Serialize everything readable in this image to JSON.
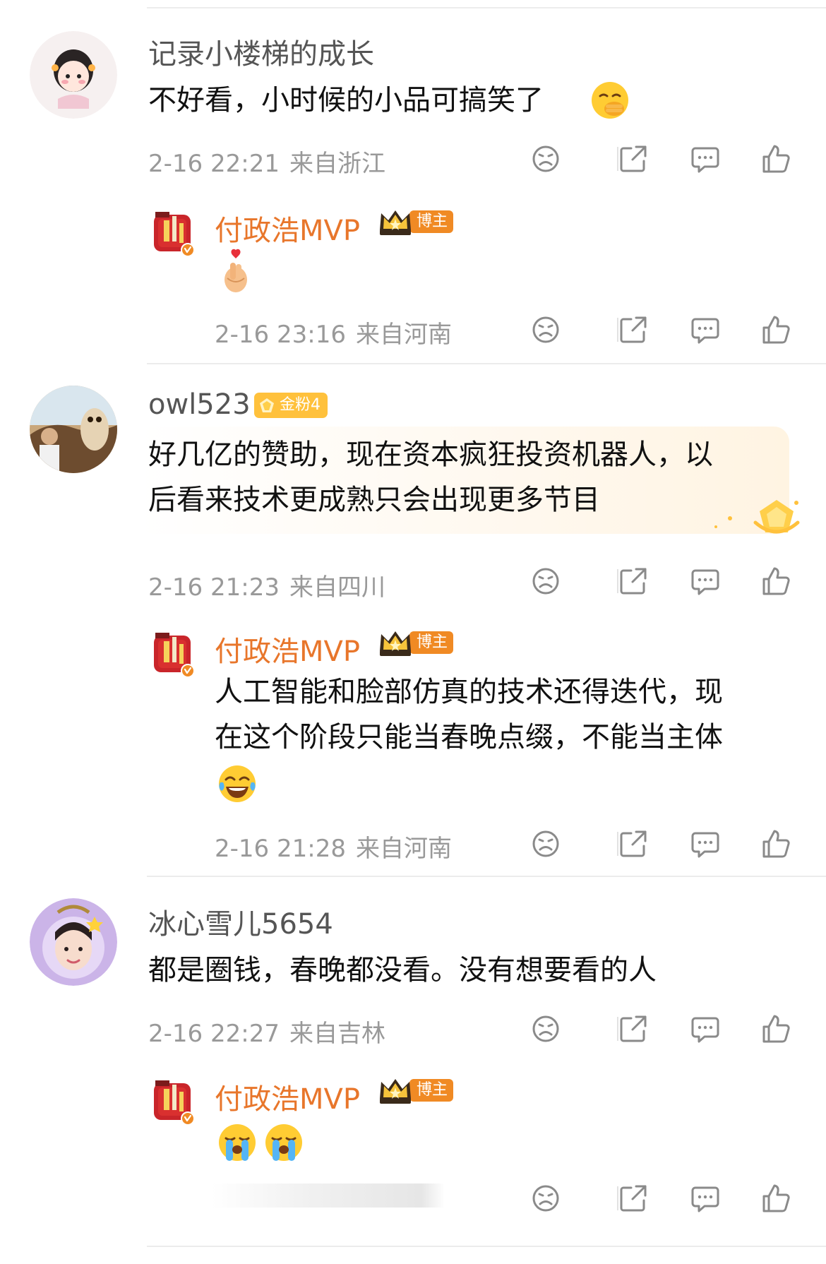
{
  "comments": [
    {
      "user": "记录小楼梯的成长",
      "text": "不好看，小时候的小品可搞笑了",
      "emoji": "hand-over-mouth-face",
      "time": "2-16 22:21",
      "location": "来自浙江",
      "reply": {
        "user": "付政浩MVP",
        "badge": "博主",
        "emoji": "finger-heart",
        "time": "2-16 23:16",
        "location": "来自河南"
      }
    },
    {
      "user": "owl523",
      "fan_badge": "金粉4",
      "text_lines": [
        "好几亿的赞助，现在资本疯狂投资机器人，以",
        "后看来技术更成熟只会出现更多节目"
      ],
      "time": "2-16 21:23",
      "location": "来自四川",
      "reply": {
        "user": "付政浩MVP",
        "badge": "博主",
        "text_lines": [
          "人工智能和脸部仿真的技术还得迭代，现",
          "在这个阶段只能当春晚点缀，不能当主体"
        ],
        "emoji": "tears-of-joy",
        "time": "2-16 21:28",
        "location": "来自河南"
      }
    },
    {
      "user": "冰心雪儿5654",
      "text": "都是圈钱，春晚都没看。没有想要看的人",
      "time": "2-16 22:27",
      "location": "来自吉林",
      "reply": {
        "user": "付政浩MVP",
        "badge": "博主",
        "emoji": "loudly-crying",
        "emoji_count": 2
      }
    }
  ],
  "icons": [
    "dislike-icon",
    "repost-icon",
    "comment-icon",
    "like-icon"
  ],
  "colors": {
    "accent": "#e8762b",
    "meta": "#999999",
    "badge": "#f08a24",
    "fan_badge": "#ffc13c"
  }
}
